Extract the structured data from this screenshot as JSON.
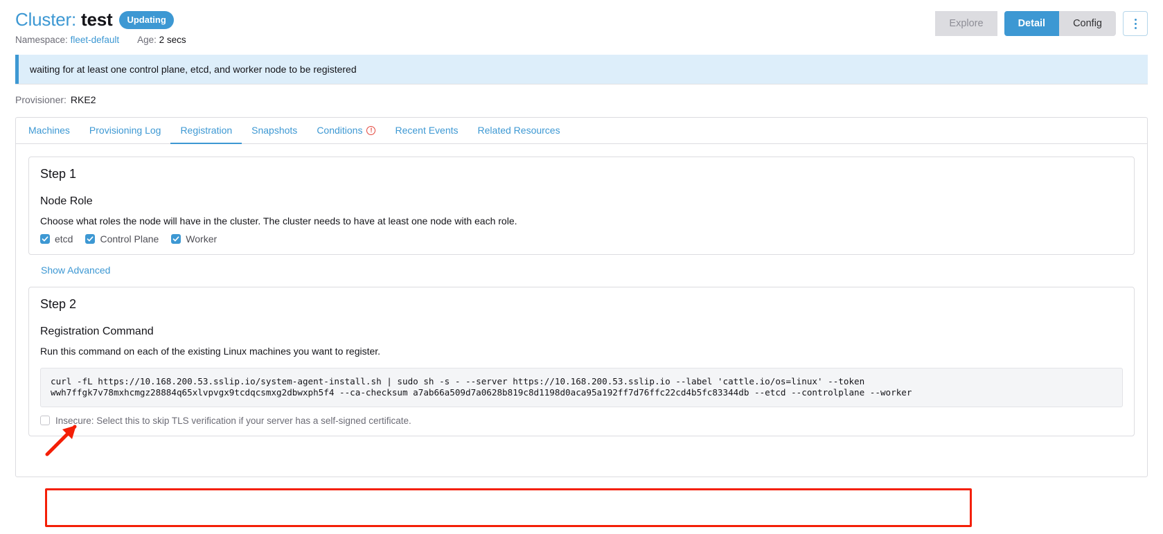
{
  "header": {
    "title_prefix": "Cluster:",
    "resource_name": "test",
    "state_badge": "Updating",
    "namespace_label": "Namespace:",
    "namespace_value": "fleet-default",
    "age_label": "Age:",
    "age_value": "2 secs",
    "accent_color": "#3d98d3"
  },
  "actions": {
    "explore": "Explore",
    "detail": "Detail",
    "config": "Config",
    "kebab": "⋮"
  },
  "banner": {
    "message": "waiting for at least one control plane, etcd, and worker node to be registered",
    "background": "#ddeefa",
    "accent": "#3d98d3"
  },
  "provisioner": {
    "label": "Provisioner:",
    "value": "RKE2"
  },
  "tabs": [
    {
      "label": "Machines",
      "active": false,
      "warning": false
    },
    {
      "label": "Provisioning Log",
      "active": false,
      "warning": false
    },
    {
      "label": "Registration",
      "active": true,
      "warning": false
    },
    {
      "label": "Snapshots",
      "active": false,
      "warning": false
    },
    {
      "label": "Conditions",
      "active": false,
      "warning": true
    },
    {
      "label": "Recent Events",
      "active": false,
      "warning": false
    },
    {
      "label": "Related Resources",
      "active": false,
      "warning": false
    }
  ],
  "step1": {
    "card_title": "Step 1",
    "section_head": "Node Role",
    "section_desc": "Choose what roles the node will have in the cluster. The cluster needs to have at least one node with each role.",
    "roles": [
      {
        "label": "etcd",
        "checked": true
      },
      {
        "label": "Control Plane",
        "checked": true
      },
      {
        "label": "Worker",
        "checked": true
      }
    ]
  },
  "show_advanced": "Show Advanced",
  "step2": {
    "card_title": "Step 2",
    "section_head": "Registration Command",
    "section_desc": "Run this command on each of the existing Linux machines you want to register.",
    "command_line1": "curl -fL https://10.168.200.53.sslip.io/system-agent-install.sh | sudo sh -s - --server https://10.168.200.53.sslip.io --label 'cattle.io/os=linux' --token",
    "command_line2": "wwh7ffgk7v78mxhcmgz28884q65xlvpvgx9tcdqcsmxg2dbwxph5f4 --ca-checksum a7ab66a509d7a0628b819c8d1198d0aca95a192ff7d76ffc22cd4b5fc83344db --etcd --controlplane --worker",
    "insecure_label": "Insecure: Select this to skip TLS verification if your server has a self-signed certificate.",
    "insecure_checked": false,
    "highlight_color": "#f41f07"
  },
  "annotation": {
    "arrow_color": "#f41f07"
  }
}
